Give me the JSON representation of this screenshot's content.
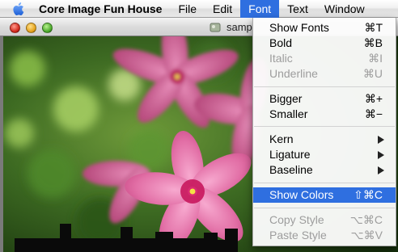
{
  "menubar": {
    "app_name": "Core Image Fun House",
    "items": [
      "File",
      "Edit",
      "Font",
      "Text",
      "Window"
    ],
    "active_item": "Font"
  },
  "window": {
    "title": "samp"
  },
  "font_menu": {
    "items": [
      {
        "label": "Show Fonts",
        "shortcut": "⌘T",
        "enabled": true
      },
      {
        "label": "Bold",
        "shortcut": "⌘B",
        "enabled": true
      },
      {
        "label": "Italic",
        "shortcut": "⌘I",
        "enabled": false
      },
      {
        "label": "Underline",
        "shortcut": "⌘U",
        "enabled": false
      },
      {
        "label": "Bigger",
        "shortcut": "⌘+",
        "enabled": true
      },
      {
        "label": "Smaller",
        "shortcut": "⌘−",
        "enabled": true
      },
      {
        "label": "Kern",
        "submenu": true,
        "enabled": true
      },
      {
        "label": "Ligature",
        "submenu": true,
        "enabled": true
      },
      {
        "label": "Baseline",
        "submenu": true,
        "enabled": true
      },
      {
        "label": "Show Colors",
        "shortcut": "⇧⌘C",
        "enabled": true,
        "highlighted": true
      },
      {
        "label": "Copy Style",
        "shortcut": "⌥⌘C",
        "enabled": false
      },
      {
        "label": "Paste Style",
        "shortcut": "⌥⌘V",
        "enabled": false
      }
    ]
  },
  "colors": {
    "menu_highlight": "#2f6fe0",
    "disabled_text": "#9d9d9d"
  }
}
